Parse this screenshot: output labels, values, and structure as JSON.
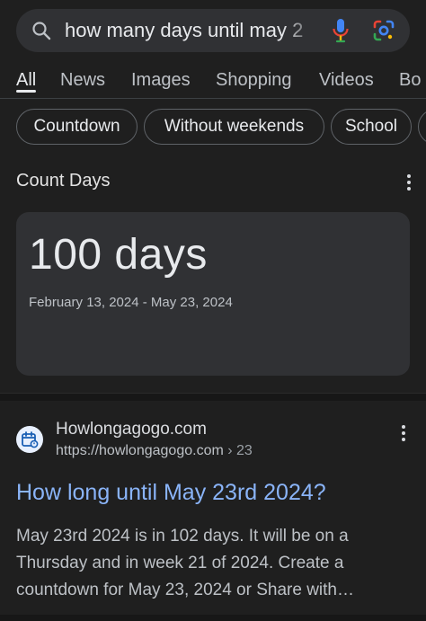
{
  "search": {
    "query": "how many days until may 2"
  },
  "tabs": [
    {
      "label": "All",
      "active": true
    },
    {
      "label": "News",
      "active": false
    },
    {
      "label": "Images",
      "active": false
    },
    {
      "label": "Shopping",
      "active": false
    },
    {
      "label": "Videos",
      "active": false
    },
    {
      "label": "Bo",
      "active": false
    }
  ],
  "chips": [
    "Countdown",
    "Without weekends",
    "School"
  ],
  "count_days": {
    "title": "Count Days",
    "value": "100 days",
    "range": "February 13, 2024 - May 23, 2024"
  },
  "result": {
    "site_name": "Howlongagogo.com",
    "url": "https://howlongagogo.com",
    "url_crumb": "› 23",
    "title": "How long until May 23rd 2024?",
    "snippet_lines": [
      "May 23rd 2024 is in 102 days. It will be on a",
      "Thursday and in week 21 of 2024. Create a",
      "countdown for May 23, 2024 or Share with…"
    ]
  },
  "colors": {
    "background": "#1f1f1f",
    "surface": "#303134",
    "link": "#8ab4f8",
    "mic_blue": "#4285f4",
    "mic_red": "#ea4335"
  },
  "icons": [
    "search-icon",
    "microphone-icon",
    "google-lens-icon",
    "more-options-icon",
    "calendar-favicon-icon"
  ]
}
